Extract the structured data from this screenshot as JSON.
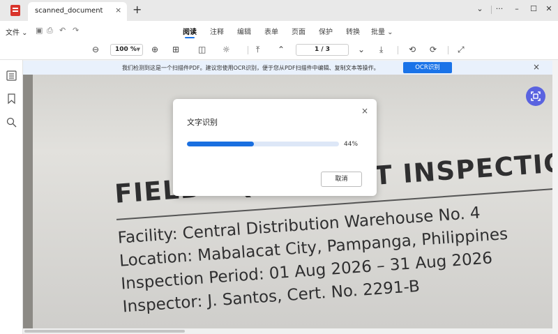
{
  "titlebar": {
    "tab_label": "scanned_document",
    "tab_close": "×",
    "new_tab": "+",
    "more": "···",
    "chevron": "⌄",
    "minimize": "–",
    "maximize": "☐",
    "close": "✕"
  },
  "menubar": {
    "file_label": "文件",
    "nav": [
      "阅读",
      "注释",
      "编辑",
      "表单",
      "页面",
      "保护",
      "转换",
      "批量"
    ],
    "active_index": 0
  },
  "toolbar": {
    "zoom": "100 %",
    "page": "1  /  3"
  },
  "notice": {
    "text": "我们检测到这是一个扫描件PDF。建议您使用OCR识别，便于您从PDF扫描件中编辑、复制文本等操作。",
    "ocr_button": "OCR识别",
    "close": "×"
  },
  "document": {
    "heading": "FIELD EQUIPMENT INSPECTION",
    "lines": [
      "Facility: Central Distribution Warehouse No. 4",
      "Location: Mabalacat City, Pampanga, Philippines",
      "Inspection Period: 01 Aug 2026 – 31 Aug 2026",
      "Inspector: J. Santos, Cert. No. 2291-B"
    ]
  },
  "dialog": {
    "title": "文字识别",
    "close": "×",
    "progress_fraction": 0.44,
    "progress_text": "44%",
    "cancel": "取消"
  },
  "colors": {
    "accent": "#1a73e8",
    "float_button": "#5a63e0",
    "notice_bg": "#e9f1fc"
  }
}
